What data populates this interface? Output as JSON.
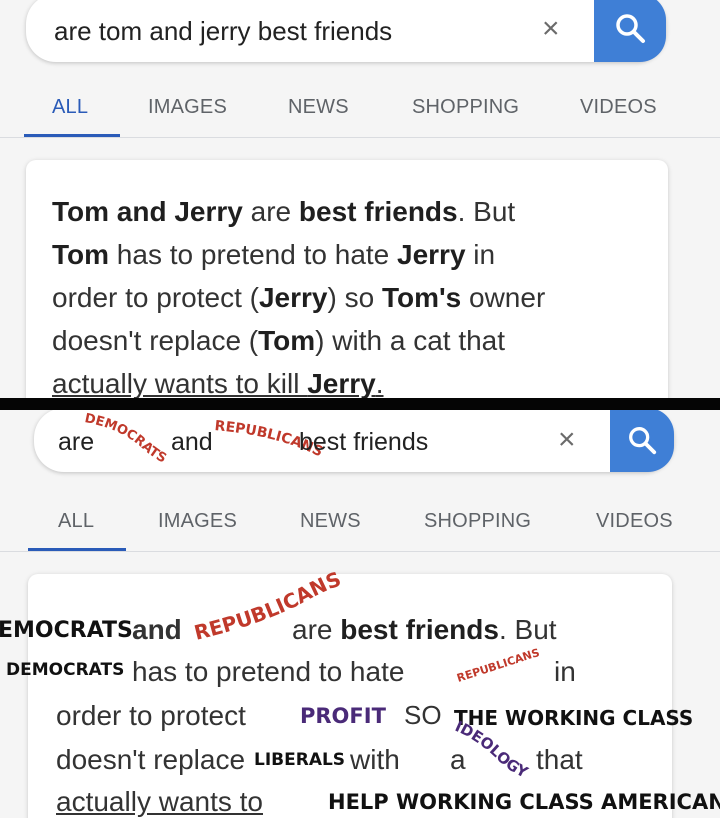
{
  "top": {
    "search": {
      "query": "are tom and jerry best friends",
      "clear": "×"
    },
    "tabs": [
      "ALL",
      "IMAGES",
      "NEWS",
      "SHOPPING",
      "VIDEOS"
    ],
    "answer": {
      "l1": {
        "a": "Tom and Jerry",
        "b": " are ",
        "c": "best friends",
        "d": ". But"
      },
      "l2": {
        "a": "Tom",
        "b": " has to pretend to hate ",
        "c": "Jerry",
        "d": " in"
      },
      "l3": {
        "a": "order to protect (",
        "b": "Jerry",
        "c": ") so ",
        "d": "Tom's",
        "e": " owner"
      },
      "l4": {
        "a": "doesn't replace (",
        "b": "Tom",
        "c": ") with a cat that"
      },
      "l5": {
        "a": "actually wants to kill ",
        "b": "Jerry",
        "c": "."
      }
    }
  },
  "bottom": {
    "search": {
      "are": "are",
      "and": "and",
      "best_friends": "best friends",
      "democrats": "DEMOCRATS",
      "republicans": "REPUBLICANS",
      "clear": "×"
    },
    "tabs": [
      "ALL",
      "IMAGES",
      "NEWS",
      "SHOPPING",
      "VIDEOS"
    ],
    "answer": {
      "l1": {
        "democrats": "EMOCRATS",
        "and": "and",
        "republicans": "REPUBLICANS",
        "rest": "are ",
        "bf": "best friends",
        "but": ". But"
      },
      "l2": {
        "democrats": "DEMOCRATS",
        "mid": "has to pretend to hate",
        "republicans": "REPUBLICANS",
        "in": "in"
      },
      "l3": {
        "a": "order to protect",
        "profit": "PROFIT",
        "so": "SO",
        "twc": "THE WORKING CLASS"
      },
      "l4": {
        "a": "doesn't replace",
        "liberals": "LIBERALS",
        "with": "with",
        "a2": "a",
        "ideology": "IDEOLOGY",
        "that": "that"
      },
      "l5": {
        "a": "actually wants to",
        "help": "HELP WORKING CLASS AMERICANS"
      }
    }
  },
  "colors": {
    "accent": "#2a5bb8",
    "search_button": "#3f7fd6",
    "stamp_red": "#c0392b",
    "stamp_purple": "#4a2a78"
  }
}
